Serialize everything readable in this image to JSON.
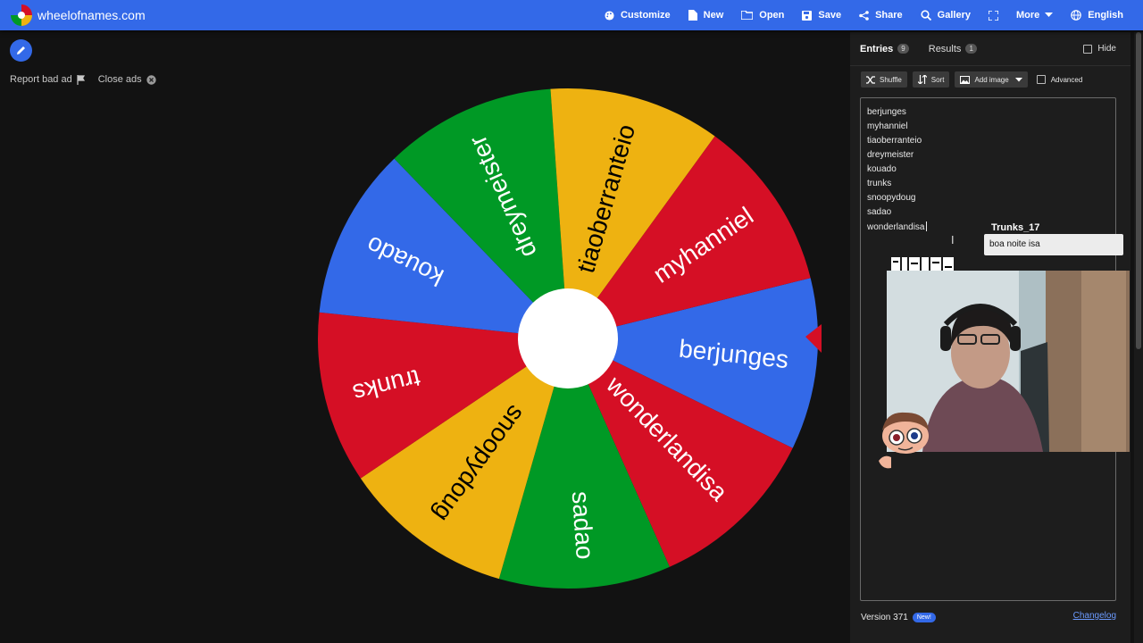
{
  "header": {
    "site_name": "wheelofnames.com",
    "menu": [
      {
        "label": "Customize",
        "icon": "palette-icon"
      },
      {
        "label": "New",
        "icon": "new-file-icon"
      },
      {
        "label": "Open",
        "icon": "folder-icon"
      },
      {
        "label": "Save",
        "icon": "save-icon"
      },
      {
        "label": "Share",
        "icon": "share-icon"
      },
      {
        "label": "Gallery",
        "icon": "search-icon"
      },
      {
        "label": "",
        "icon": "fullscreen-icon"
      },
      {
        "label": "More",
        "icon": "chevron-down-icon"
      },
      {
        "label": "English",
        "icon": "globe-icon"
      }
    ]
  },
  "left": {
    "report_ad": "Report bad ad",
    "close_ads": "Close ads"
  },
  "wheel": {
    "colors": [
      "#3369e8",
      "#d50f25",
      "#eeb211",
      "#009925"
    ],
    "segments": [
      {
        "label": "berjunges",
        "color": "#3369e8"
      },
      {
        "label": "wonderlandisa",
        "color": "#d50f25"
      },
      {
        "label": "sadao",
        "color": "#009925"
      },
      {
        "label": "snoopydoug",
        "color": "#eeb211"
      },
      {
        "label": "trunks",
        "color": "#d50f25"
      },
      {
        "label": "kouado",
        "color": "#3369e8"
      },
      {
        "label": "dreymeister",
        "color": "#009925"
      },
      {
        "label": "tiaoberranteio",
        "color": "#eeb211"
      },
      {
        "label": "myhanniel",
        "color": "#d50f25"
      }
    ],
    "pointer_color": "#d50f25"
  },
  "panel": {
    "tabs": [
      {
        "label": "Entries",
        "count": "9"
      },
      {
        "label": "Results",
        "count": "1"
      }
    ],
    "hide_label": "Hide",
    "toolbar": {
      "shuffle": "Shuffle",
      "sort": "Sort",
      "add_image": "Add image",
      "advanced": "Advanced"
    },
    "entries": [
      "berjunges",
      "myhanniel",
      "tiaoberranteio",
      "dreymeister",
      "kouado",
      "trunks",
      "snoopydoug",
      "sadao",
      "wonderlandisa"
    ]
  },
  "chat": {
    "user": "Trunks_17",
    "message": "boa noite isa"
  },
  "footer": {
    "version": "Version 371",
    "new_badge": "New!",
    "changelog": "Changelog"
  }
}
